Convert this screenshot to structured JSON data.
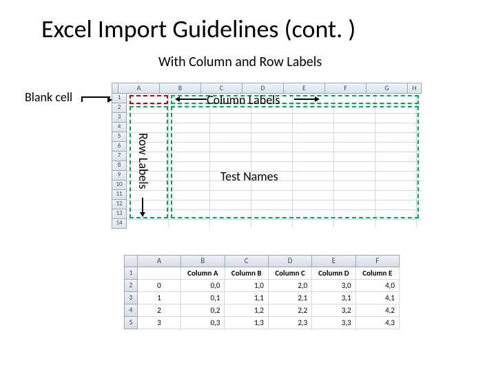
{
  "title": "Excel Import Guidelines (cont. )",
  "subtitle": "With Column and Row Labels",
  "annotations": {
    "blank_cell": "Blank cell",
    "column_labels": "Column Labels",
    "row_labels": "Row Labels",
    "test_names": "Test Names"
  },
  "sheet1": {
    "cols": [
      "A",
      "B",
      "C",
      "D",
      "E",
      "F",
      "G",
      "H"
    ],
    "rows": [
      "1",
      "2",
      "3",
      "4",
      "5",
      "6",
      "7",
      "8",
      "9",
      "10",
      "11",
      "12",
      "13",
      "14"
    ]
  },
  "sheet2": {
    "cols": [
      "A",
      "B",
      "C",
      "D",
      "E",
      "F"
    ],
    "rows": [
      "1",
      "2",
      "3",
      "4",
      "5"
    ],
    "cells": [
      [
        "",
        "Column A",
        "Column B",
        "Column C",
        "Column D",
        "Column E"
      ],
      [
        "0",
        "0,0",
        "1,0",
        "2,0",
        "3,0",
        "4,0"
      ],
      [
        "1",
        "0,1",
        "1,1",
        "2,1",
        "3,1",
        "4,1"
      ],
      [
        "2",
        "0,2",
        "1,2",
        "2,2",
        "3,2",
        "4,2"
      ],
      [
        "3",
        "0,3",
        "1,3",
        "2,3",
        "3,3",
        "4,3"
      ]
    ]
  }
}
